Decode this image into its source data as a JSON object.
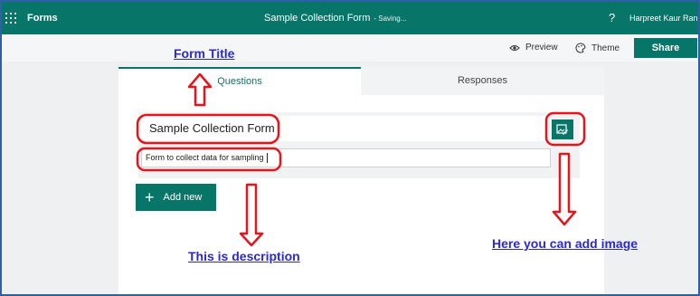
{
  "app": {
    "name": "Forms",
    "form_title": "Sample Collection Form",
    "saving_status": "- Saving...",
    "help": "?",
    "user": "Harpreet Kaur Ran..."
  },
  "toolbar": {
    "preview_label": "Preview",
    "theme_label": "Theme",
    "share_label": "Share"
  },
  "tabs": [
    {
      "label": "Questions",
      "active": true
    },
    {
      "label": "Responses",
      "active": false
    }
  ],
  "form": {
    "title": "Sample Collection Form",
    "description": "Form to collect data for sampling",
    "add_new_label": "Add new"
  },
  "annotations": {
    "form_title": "Form Title",
    "description": "This is description",
    "image": "Here you can add image"
  },
  "colors": {
    "brand": "#077568",
    "annotation_text": "#2a2ad0",
    "annotation_marker": "#e8141b"
  }
}
